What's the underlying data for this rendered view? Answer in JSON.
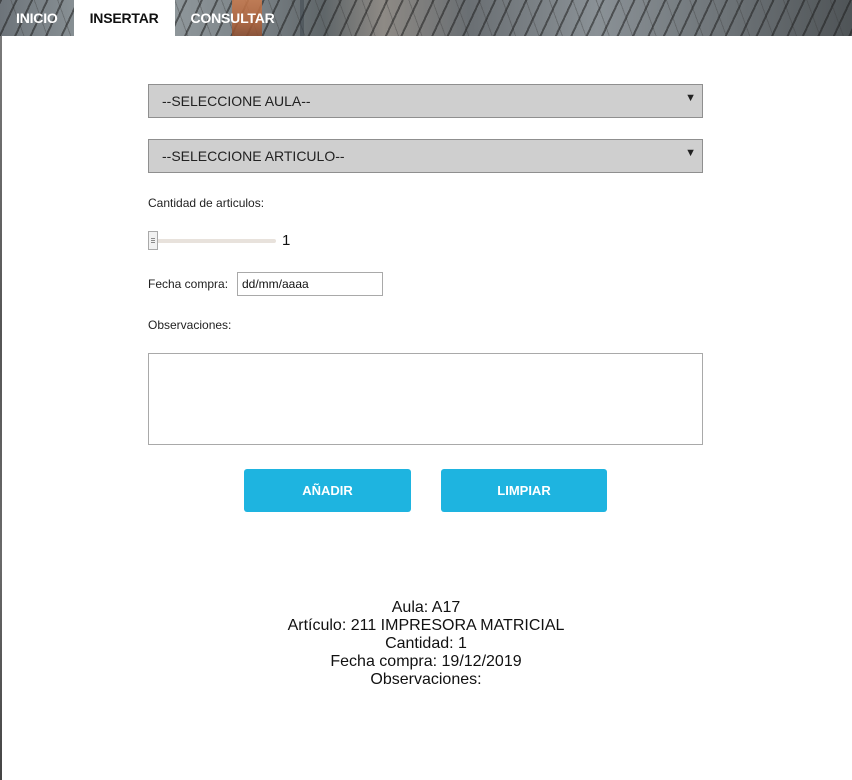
{
  "nav": {
    "items": [
      {
        "label": "INICIO"
      },
      {
        "label": "INSERTAR"
      },
      {
        "label": "CONSULTAR"
      }
    ],
    "active": "INSERTAR"
  },
  "form": {
    "aula_select": {
      "selected": "--SELECCIONE AULA--",
      "icon": "chevron-down-icon"
    },
    "articulo_select": {
      "selected": "--SELECCIONE ARTICULO--",
      "icon": "chevron-down-icon"
    },
    "cantidad_label": "Cantidad de articulos:",
    "cantidad_value": "1",
    "fecha_label": "Fecha compra:",
    "fecha_placeholder": "dd/mm/aaaa",
    "observaciones_label": "Observaciones:",
    "observaciones_value": ""
  },
  "buttons": {
    "add": "AÑADIR",
    "clear": "LIMPIAR"
  },
  "summary": {
    "aula": "Aula: A17",
    "articulo": "Artículo: 211 IMPRESORA MATRICIAL",
    "cantidad": "Cantidad: 1",
    "fecha": "Fecha compra: 19/12/2019",
    "observaciones": "Observaciones:"
  },
  "colors": {
    "button": "#1eb4e0",
    "select_bg": "#cfcfcf"
  }
}
